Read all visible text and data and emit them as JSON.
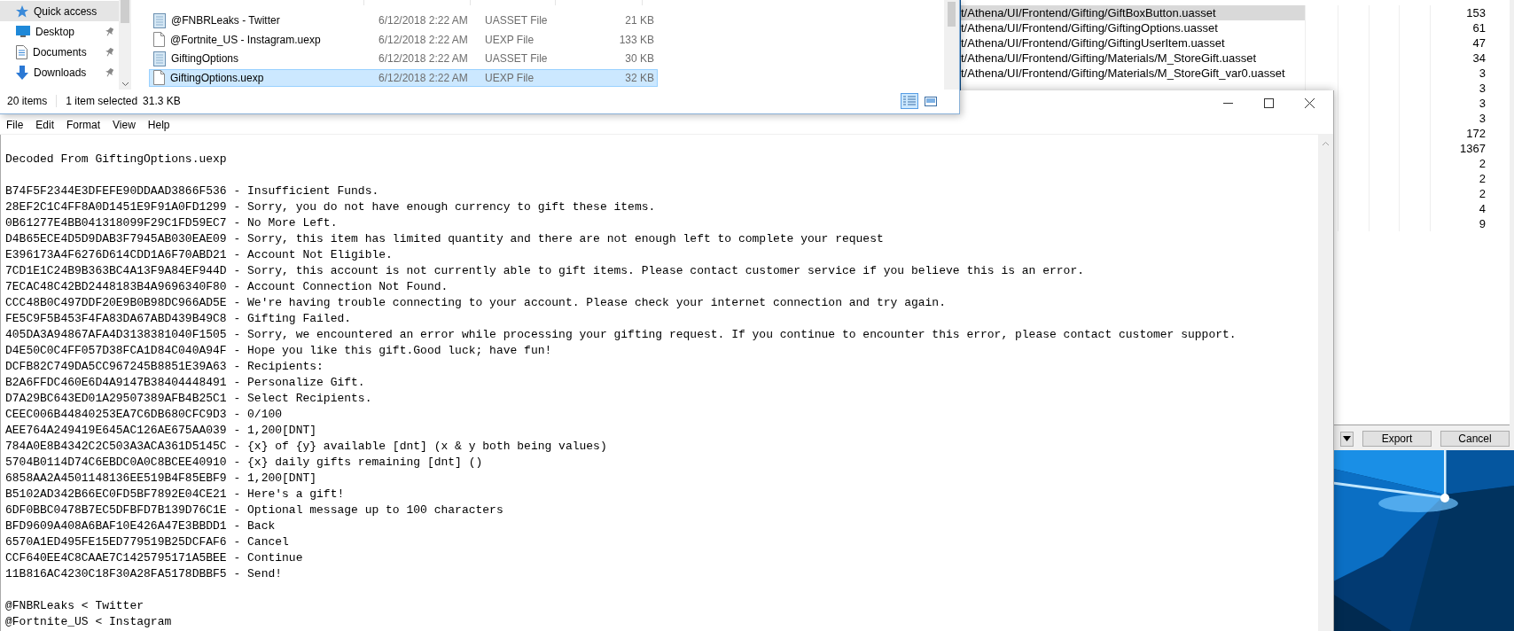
{
  "explorer": {
    "nav_items": [
      {
        "label": "Quick access",
        "kind": "star",
        "selected": true,
        "pinned": false
      },
      {
        "label": "Desktop",
        "kind": "desktop",
        "selected": false,
        "pinned": true
      },
      {
        "label": "Documents",
        "kind": "document",
        "selected": false,
        "pinned": true
      },
      {
        "label": "Downloads",
        "kind": "download",
        "selected": false,
        "pinned": true
      }
    ],
    "files": [
      {
        "name": "@FNBRLeaks - Twitter",
        "date": "6/12/2018 2:22 AM",
        "type": "UASSET File",
        "size": "21 KB",
        "kind": "uasset",
        "selected": false
      },
      {
        "name": "@Fortnite_US - Instagram.uexp",
        "date": "6/12/2018 2:22 AM",
        "type": "UEXP File",
        "size": "133 KB",
        "kind": "uexp",
        "selected": false
      },
      {
        "name": "GiftingOptions",
        "date": "6/12/2018 2:22 AM",
        "type": "UASSET File",
        "size": "30 KB",
        "kind": "uasset",
        "selected": false
      },
      {
        "name": "GiftingOptions.uexp",
        "date": "6/12/2018 2:22 AM",
        "type": "UEXP File",
        "size": "32 KB",
        "kind": "uexp",
        "selected": true
      }
    ],
    "status_bar": {
      "count": "20 items",
      "selection": "1 item selected",
      "size": "31.3 KB"
    }
  },
  "exporter": {
    "rows": [
      {
        "path": "t/Athena/UI/Frontend/Gifting/GiftBoxButton.uasset",
        "count": "153",
        "selected": true
      },
      {
        "path": "t/Athena/UI/Frontend/Gifting/GiftingOptions.uasset",
        "count": "61",
        "selected": false
      },
      {
        "path": "t/Athena/UI/Frontend/Gifting/GiftingUserItem.uasset",
        "count": "47",
        "selected": false
      },
      {
        "path": "t/Athena/UI/Frontend/Gifting/Materials/M_StoreGift.uasset",
        "count": "34",
        "selected": false
      },
      {
        "path": "t/Athena/UI/Frontend/Gifting/Materials/M_StoreGift_var0.uasset",
        "count": "3",
        "selected": false
      },
      {
        "count": "3"
      },
      {
        "count": "3"
      },
      {
        "count": "3"
      },
      {
        "count": "172"
      },
      {
        "count": "1367"
      },
      {
        "count": "2"
      },
      {
        "count": "2"
      },
      {
        "count": "2"
      },
      {
        "count": "4"
      },
      {
        "count": "9"
      }
    ],
    "buttons": [
      "Export",
      "Cancel"
    ]
  },
  "notepad": {
    "menu": [
      "File",
      "Edit",
      "Format",
      "View",
      "Help"
    ],
    "heading": "Decoded From GiftingOptions.uexp",
    "entries": [
      "B74F5F2344E3DFEFE90DDAAD3866F536 - Insufficient Funds.",
      "28EF2C1C4FF8A0D1451E9F91A0FD1299 - Sorry, you do not have enough currency to gift these items.",
      "0B61277E4BB041318099F29C1FD59EC7 - No More Left.",
      "D4B65ECE4D5D9DAB3F7945AB030EAE09 - Sorry, this item has limited quantity and there are not enough left to complete your request",
      "E396173A4F6276D614CDD1A6F70ABD21 - Account Not Eligible.",
      "7CD1E1C24B9B363BC4A13F9A84EF944D - Sorry, this account is not currently able to gift items. Please contact customer service if you believe this is an error.",
      "7ECAC48C42BD2448183B4A9696340F80 - Account Connection Not Found.",
      "CCC48B0C497DDF20E9B0B98DC966AD5E - We're having trouble connecting to your account. Please check your internet connection and try again.",
      "FE5C9F5B453F4FA83DA67ABD439B49C8 - Gifting Failed.",
      "405DA3A94867AFA4D3138381040F1505 - Sorry, we encountered an error while processing your gifting request. If you continue to encounter this error, please contact customer support.",
      "D4E50C0C4FF057D38FCA1D84C040A94F - Hope you like this gift.Good luck; have fun!",
      "DCFB82C749DA5CC967245B8851E39A63 - Recipients:",
      "B2A6FFDC460E6D4A9147B38404448491 - Personalize Gift.",
      "D7A29BC643ED01A29507389AFB4B25C1 - Select Recipients.",
      "CEEC006B44840253EA7C6DB680CFC9D3 - 0/100",
      "AEE764A249419E645AC126AE675AA039 - 1,200[DNT]",
      "784A0E8B4342C2C503A3ACA361D5145C - {x} of {y} available [dnt] (x & y both being values)",
      "5704B0114D74C6EBDC0A0C8BCEE40910 - {x} daily gifts remaining [dnt] ()",
      "6858AA2A4501148136EE519B4F85EBF9 - 1,200[DNT]",
      "B5102AD342B66EC0FD5BF7892E04CE21 - Here's a gift!",
      "6DF0BBC0478B7EC5DFBFD7B139D76C1E - Optional message up to 100 characters",
      "BFD9609A408A6BAF10E426A47E3BBDD1 - Back",
      "6570A1ED495FE15ED779519B25DCFAF6 - Cancel",
      "CCF640EE4C8CAAE7C1425795171A5BEE - Continue",
      "11B816AC4230C18F30A28FA5178DBBF5 - Send!"
    ],
    "credits": [
      "@FNBRLeaks < Twitter",
      "@Fortnite_US < Instagram"
    ]
  }
}
